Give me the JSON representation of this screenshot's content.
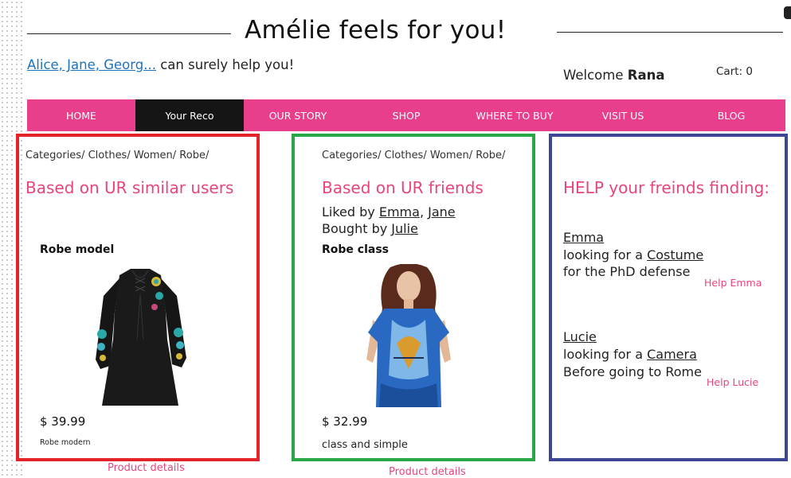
{
  "header": {
    "title": "Amélie feels for you!",
    "helpers_link": "Alice, Jane, Georg...",
    "helpers_text": " can surely help you!",
    "welcome_prefix": "Welcome ",
    "welcome_user": "Rana",
    "cart": "Cart: 0"
  },
  "nav": [
    "HOME",
    "Your Reco",
    "OUR STORY",
    "SHOP",
    "WHERE TO BUY",
    "VISIT US",
    "BLOG"
  ],
  "nav_active": "Your Reco",
  "similar_users": {
    "breadcrumb": "Categories/ Clothes/ Women/ Robe/",
    "heading": "Based on UR similar users",
    "product_name": "Robe model",
    "price": "$ 39.99",
    "description": "Robe modern",
    "details_link": "Product details"
  },
  "friends": {
    "breadcrumb": "Categories/ Clothes/ Women/ Robe/",
    "heading": "Based on UR friends",
    "liked_prefix": "Liked by ",
    "liked_name_1": "Emma",
    "liked_sep": ", ",
    "liked_name_2": "Jane",
    "bought_prefix": "Bought by ",
    "bought_name": "Julie",
    "product_name": "Robe class",
    "price": "$ 32.99",
    "description": "class and simple",
    "details_link": "Product details"
  },
  "help": {
    "heading": "HELP your freinds finding:",
    "requests": [
      {
        "name": "Emma",
        "looking_prefix": "looking for a ",
        "item": "Costume",
        "reason": "for the PhD defense",
        "help_link": "Help Emma"
      },
      {
        "name": "Lucie",
        "looking_prefix": "looking for a ",
        "item": "Camera",
        "reason": "Before going to Rome",
        "help_link": "Help Lucie"
      }
    ]
  },
  "colors": {
    "accent_pink": "#e93e8c",
    "nav_active_bg": "#151515",
    "panel_red": "#e3242b",
    "panel_green": "#28a745",
    "panel_blue": "#3d4796",
    "link_blue": "#1e73be"
  }
}
